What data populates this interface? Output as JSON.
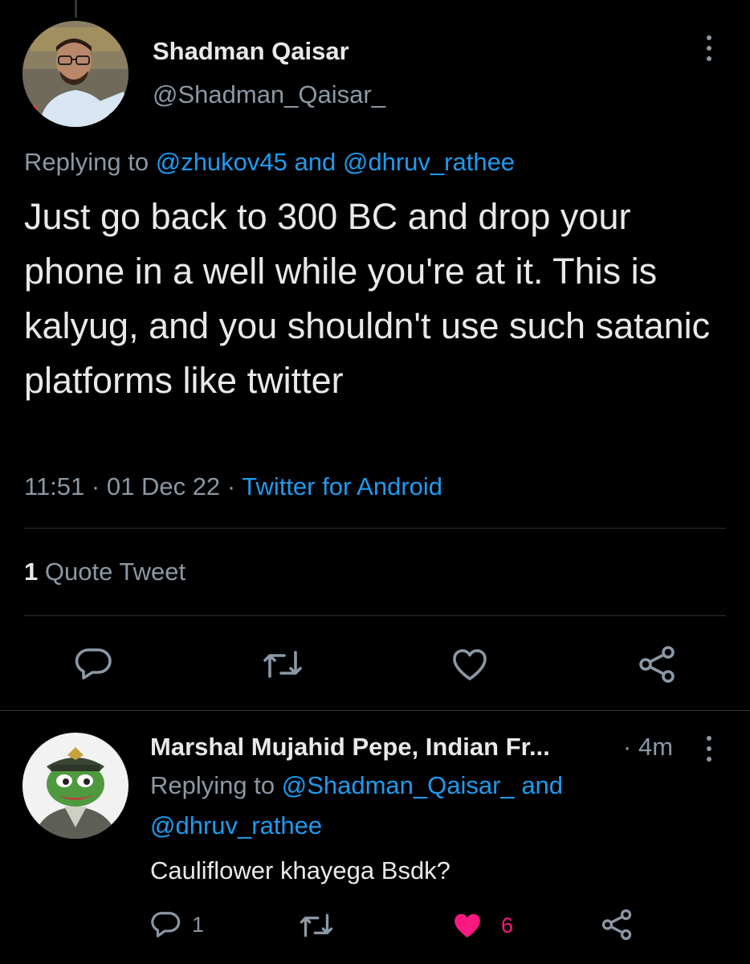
{
  "main_tweet": {
    "author_name": "Shadman Qaisar",
    "author_handle": "@Shadman_Qaisar_",
    "replying_prefix": "Replying to",
    "replying_user1": "@zhukov45",
    "replying_and": "and",
    "replying_user2": "@dhruv_rathee",
    "text": "Just go back to 300 BC and drop your phone in a well while you're at it. This is kalyug, and you shouldn't use such satanic platforms like twitter",
    "time": "11:51",
    "date": "01 Dec 22",
    "separator": "·",
    "source": "Twitter for Android",
    "quote_count": "1",
    "quote_label": "Quote Tweet",
    "icons": [
      "reply-icon",
      "retweet-icon",
      "like-icon",
      "share-icon",
      "more-icon"
    ]
  },
  "reply_tweet": {
    "author_name": "Marshal Mujahid Pepe, Indian Fr...",
    "time_separator": "·",
    "time": "4m",
    "replying_prefix": "Replying to",
    "replying_user1": "@Shadman_Qaisar_",
    "replying_and": "and",
    "replying_user2": "@dhruv_rathee",
    "text": "Cauliflower khayega Bsdk?",
    "reply_count": "1",
    "like_count": "6",
    "liked": true,
    "icons": [
      "reply-icon",
      "retweet-icon",
      "like-icon-filled",
      "share-icon",
      "more-icon"
    ]
  },
  "colors": {
    "background": "#000000",
    "text": "#e7e9ea",
    "secondary": "#8b98a5",
    "link": "#1d9bf0",
    "like": "#f91880"
  }
}
